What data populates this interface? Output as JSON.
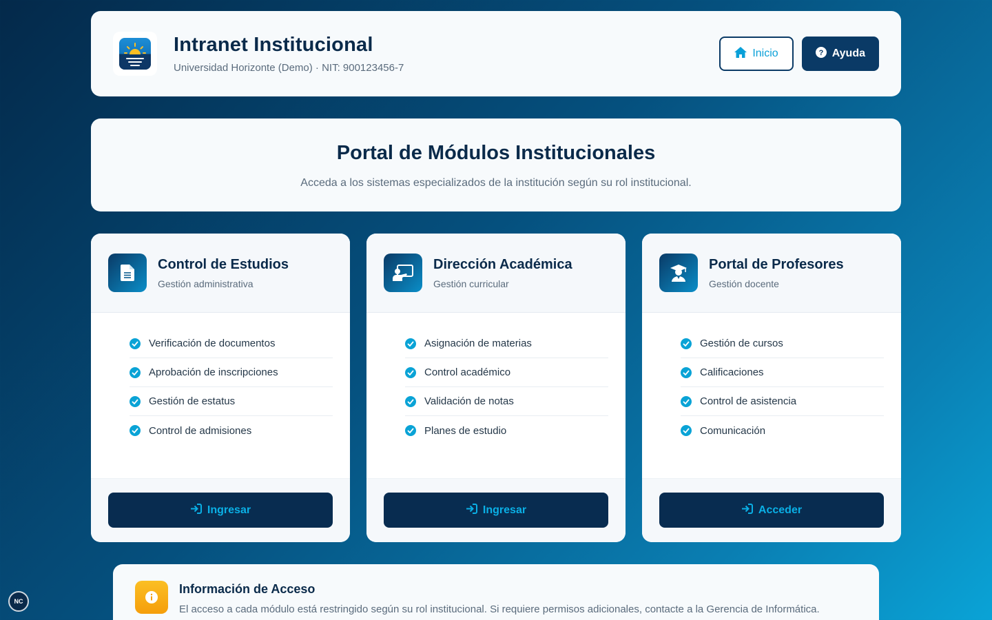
{
  "header": {
    "title": "Intranet Institucional",
    "subtitle": "Universidad Horizonte (Demo) · NIT: 900123456-7",
    "home_label": "Inicio",
    "help_label": "Ayuda"
  },
  "intro": {
    "title": "Portal de Módulos Institucionales",
    "subtitle": "Acceda a los sistemas especializados de la institución según su rol institucional."
  },
  "cards": [
    {
      "title": "Control de Estudios",
      "subtitle": "Gestión administrativa",
      "icon": "document-icon",
      "features": [
        "Verificación de documentos",
        "Aprobación de inscripciones",
        "Gestión de estatus",
        "Control de admisiones"
      ],
      "button": "Ingresar"
    },
    {
      "title": "Dirección Académica",
      "subtitle": "Gestión curricular",
      "icon": "teacher-board-icon",
      "features": [
        "Asignación de materias",
        "Control académico",
        "Validación de notas",
        "Planes de estudio"
      ],
      "button": "Ingresar"
    },
    {
      "title": "Portal de Profesores",
      "subtitle": "Gestión docente",
      "icon": "graduate-icon",
      "features": [
        "Gestión de cursos",
        "Calificaciones",
        "Control de asistencia",
        "Comunicación"
      ],
      "button": "Acceder"
    }
  ],
  "info": {
    "title": "Información de Acceso",
    "text": "El acceso a cada módulo está restringido según su rol institucional. Si requiere permisos adicionales, contacte a la Gerencia de Informática."
  },
  "badge": "NC",
  "colors": {
    "primary": "#0a3a66",
    "accent": "#0aa3d6",
    "warning": "#f59e0b"
  }
}
